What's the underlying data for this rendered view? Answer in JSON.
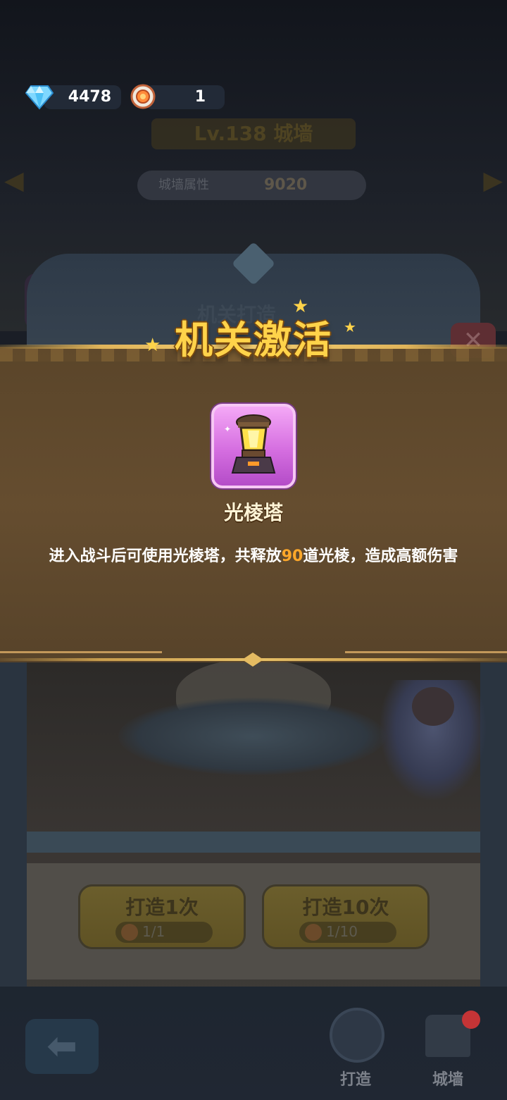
{
  "currency": {
    "diamonds": "4478",
    "tokens": "1"
  },
  "background": {
    "title": "Lv.138 城墙",
    "stat_label": "城墙属性",
    "stat_value": "9020",
    "panel_title": "机关打造"
  },
  "popup": {
    "title": "机关激活",
    "item_name": "光棱塔",
    "desc_before": "进入战斗后可使用光棱塔，共释放",
    "desc_highlight": "90",
    "desc_after": "道光棱，造成高额伤害",
    "highlight_color": "#ffa82a",
    "item_rarity_color": "#d56ee0"
  },
  "forge_buttons": [
    {
      "label": "打造1次",
      "cost": "1/1"
    },
    {
      "label": "打造10次",
      "cost": "1/10"
    }
  ],
  "bottom_nav": {
    "forge_label": "打造",
    "wall_label": "城墙"
  }
}
